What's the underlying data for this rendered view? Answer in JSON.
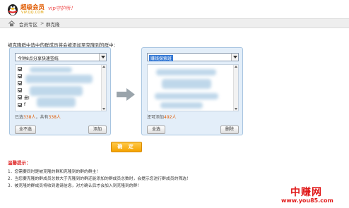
{
  "header": {
    "logo_title": "超级会员",
    "logo_sub": "VIP.QQ.COM",
    "slogan": "vip守护所！"
  },
  "breadcrumb": {
    "items": [
      "会员专区",
      "群克隆"
    ],
    "separator": ">"
  },
  "instruction": "被克隆群中选中的群成员将会被添加至克隆到的群中：",
  "source_panel": {
    "selected_group": "今钟8点分享快速签统",
    "members": [
      {
        "checked": true,
        "name": ""
      },
      {
        "checked": true,
        "name": ""
      },
      {
        "checked": true,
        "name": ""
      },
      {
        "checked": true,
        "name": ""
      },
      {
        "checked": true,
        "name": "曼l"
      },
      {
        "checked": true,
        "name": "f"
      }
    ],
    "count_prefix": "已选",
    "count_selected": "338人",
    "count_mid": "，共有",
    "count_total": "338人",
    "select_all_label": "全不选",
    "add_label": "添加"
  },
  "target_panel": {
    "selected_group": "赚钱探索班",
    "count_prefix": "还可添加",
    "count_available": "492人",
    "select_all_label": "全选",
    "delete_label": "删除"
  },
  "confirm_label": "确 定",
  "tips": {
    "title": "温馨提示：",
    "items": [
      "1．您需要同时是被克隆的群和克隆到的群的群主！",
      "2．当您要克隆的群成员总数大于克隆到的群还能添加的群成员总数时，会提示您进行群成员的筛选！",
      "3．被克隆的群成员将收到邀请信息，对方确认后才会加入到克隆到的群！"
    ]
  },
  "watermark": {
    "brand": "中赚网",
    "url": "www.you85.com"
  },
  "colors": {
    "accent_orange": "#f5a300",
    "panel_bg": "#e3eef9",
    "tip_title": "#e03030"
  }
}
